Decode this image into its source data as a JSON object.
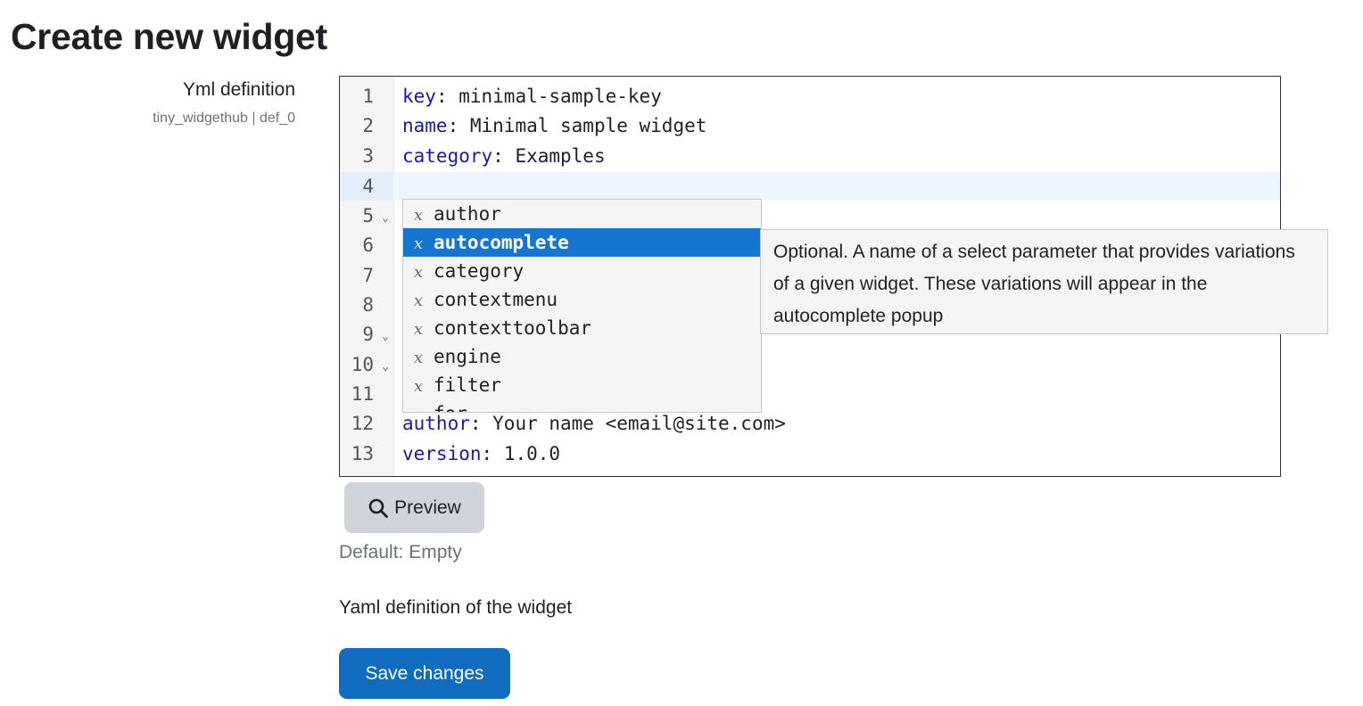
{
  "page": {
    "title": "Create new widget"
  },
  "setting": {
    "label": "Yml definition",
    "key": "tiny_widgethub | def_0",
    "default": "Default: Empty",
    "description": "Yaml definition of the widget"
  },
  "editor": {
    "line_numbers": [
      "1",
      "2",
      "3",
      "4",
      "5",
      "6",
      "7",
      "8",
      "9",
      "10",
      "11",
      "12",
      "13"
    ],
    "fold_markers": [
      "5",
      "9",
      "10"
    ],
    "active_line": 4,
    "lines": [
      {
        "key": "key",
        "sep": ": ",
        "value": "minimal-sample-key"
      },
      {
        "key": "name",
        "sep": ": ",
        "value": "Minimal sample widget"
      },
      {
        "key": "category",
        "sep": ": ",
        "value": "Examples"
      },
      {
        "key": "author",
        "sep": ": ",
        "value": "Your name <email@site.com>"
      },
      {
        "key": "version",
        "sep": ": ",
        "value": "1.0.0"
      }
    ]
  },
  "autocomplete": {
    "icon_glyph": "x",
    "items": [
      "author",
      "autocomplete",
      "category",
      "contextmenu",
      "contexttoolbar",
      "engine",
      "filter",
      "for"
    ],
    "selected_index": 1,
    "tooltip": "Optional. A name of a select parameter that provides variations of a given widget. These variations will appear in the autocomplete popup"
  },
  "buttons": {
    "preview_label": "Preview",
    "save_label": "Save changes"
  },
  "colors": {
    "primary": "#0f6cbf",
    "selected_item": "#1675d1",
    "yaml_key": "#1a1aa6",
    "secondary_button": "#ced4da"
  }
}
